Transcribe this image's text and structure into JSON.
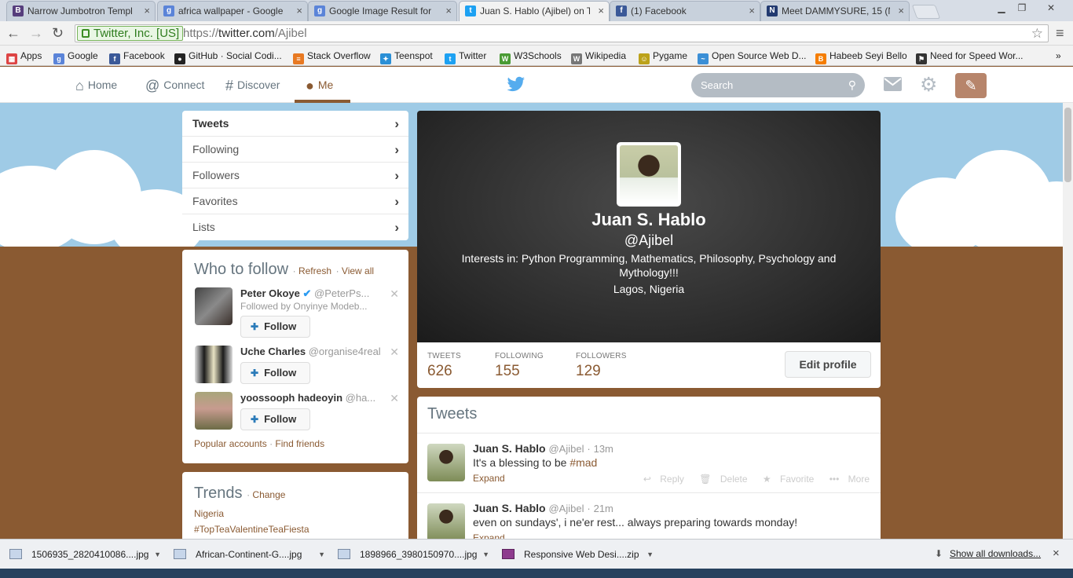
{
  "browser": {
    "tabs": [
      {
        "label": "Narrow Jumbotron Templ",
        "icon": "B",
        "color": "#563d7c"
      },
      {
        "label": "africa wallpaper - Google",
        "icon": "g",
        "color": "#5b84d8"
      },
      {
        "label": "Google Image Result for",
        "icon": "g",
        "color": "#5b84d8"
      },
      {
        "label": "Juan S. Hablo (Ajibel) on T",
        "icon": "t",
        "color": "#1da1f2"
      },
      {
        "label": "(1) Facebook",
        "icon": "f",
        "color": "#3b5998"
      },
      {
        "label": "Meet DAMMYSURE, 15 (N",
        "icon": "N",
        "color": "#223a70"
      }
    ],
    "close_glyph": "×",
    "ev_cert": "Twitter, Inc. [US]",
    "url_scheme": "https://",
    "url_host": "twitter.com",
    "url_path": "/Ajibel",
    "bookmarks": [
      {
        "label": "Apps",
        "icon": "▦",
        "color": "#d44"
      },
      {
        "label": "Google",
        "icon": "g",
        "color": "#5b84d8"
      },
      {
        "label": "Facebook",
        "icon": "f",
        "color": "#3b5998"
      },
      {
        "label": "GitHub · Social Codi...",
        "icon": "●",
        "color": "#222"
      },
      {
        "label": "Stack Overflow",
        "icon": "≡",
        "color": "#e87922"
      },
      {
        "label": "Teenspot",
        "icon": "✦",
        "color": "#2a8fd6"
      },
      {
        "label": "Twitter",
        "icon": "t",
        "color": "#1da1f2"
      },
      {
        "label": "W3Schools",
        "icon": "W",
        "color": "#4a9b34"
      },
      {
        "label": "Wikipedia",
        "icon": "W",
        "color": "#777"
      },
      {
        "label": "Pygame",
        "icon": "☺",
        "color": "#bca21a"
      },
      {
        "label": "Open Source Web D...",
        "icon": "~",
        "color": "#3b8fd6"
      },
      {
        "label": "Habeeb Seyi Bello",
        "icon": "B",
        "color": "#f57d00"
      },
      {
        "label": "Need for Speed Wor...",
        "icon": "⚑",
        "color": "#333"
      }
    ],
    "bookmarks_more": "»"
  },
  "twitter": {
    "nav": {
      "home": "Home",
      "connect": "Connect",
      "discover": "Discover",
      "me": "Me"
    },
    "search_placeholder": "Search",
    "profile_nav": [
      "Tweets",
      "Following",
      "Followers",
      "Favorites",
      "Lists"
    ],
    "who_to_follow": {
      "title": "Who to follow",
      "refresh": "Refresh",
      "view_all": "View all",
      "users": [
        {
          "name": "Peter Okoye",
          "handle": "@PeterPs...",
          "sub": "Followed by Onyinye Modeb..."
        },
        {
          "name": "Uche Charles",
          "handle": "@organise4real"
        },
        {
          "name": "yoossooph hadeoyin",
          "handle": "@ha..."
        }
      ],
      "follow_label": "Follow",
      "popular": "Popular accounts",
      "find_friends": "Find friends"
    },
    "trends": {
      "title": "Trends",
      "change": "Change",
      "location": "Nigeria",
      "items": [
        "#TopTeaValentineTeaFiesta"
      ]
    },
    "profile": {
      "name": "Juan S. Hablo",
      "handle": "@Ajibel",
      "bio": "Interests in: Python Programming, Mathematics, Philosophy, Psychology and Mythology!!!",
      "location": "Lagos, Nigeria"
    },
    "stats": {
      "tweets_label": "TWEETS",
      "tweets": "626",
      "following_label": "FOLLOWING",
      "following": "155",
      "followers_label": "FOLLOWERS",
      "followers": "129",
      "edit_profile": "Edit profile"
    },
    "tweets_header": "Tweets",
    "tweets": [
      {
        "name": "Juan S. Hablo",
        "handle": "@Ajibel",
        "time": "13m",
        "text_pre": "It's a blessing to be ",
        "hashtag": "#mad",
        "expand": "Expand"
      },
      {
        "name": "Juan S. Hablo",
        "handle": "@Ajibel",
        "time": "21m",
        "text_pre": "even on sundays', i ne'er rest... always preparing towards monday!",
        "hashtag": "",
        "expand": "Expand"
      }
    ],
    "tweet_actions": {
      "reply": "Reply",
      "delete": "Delete",
      "favorite": "Favorite",
      "more": "More"
    }
  },
  "downloads": {
    "items": [
      "1506935_2820410086....jpg",
      "African-Continent-G....jpg",
      "1898966_3980150970....jpg",
      "Responsive Web Desi....zip"
    ],
    "show_all": "Show all downloads...",
    "close": "×"
  },
  "colors": {
    "link": "#8a5a32",
    "twitter_blue": "#2b7bb9",
    "sky": "#9fcbe6",
    "ground": "#8a5a32"
  }
}
